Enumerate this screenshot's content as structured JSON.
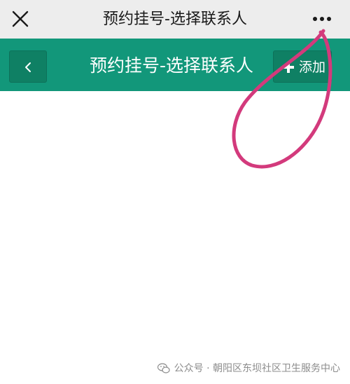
{
  "wechat_bar": {
    "title": "预约挂号-选择联系人",
    "close_icon": "close-icon",
    "more_icon": "more-icon"
  },
  "app_header": {
    "title": "预约挂号-选择联系人",
    "back_icon": "chevron-left-icon",
    "add_button": {
      "icon": "plus-icon",
      "label": "添加"
    },
    "colors": {
      "header_bg": "#12977a",
      "button_bg": "#0f8064"
    }
  },
  "annotation": {
    "color": "#d33a7c"
  },
  "watermark": {
    "text": "公众号 · 朝阳区东坝社区卫生服务中心"
  }
}
